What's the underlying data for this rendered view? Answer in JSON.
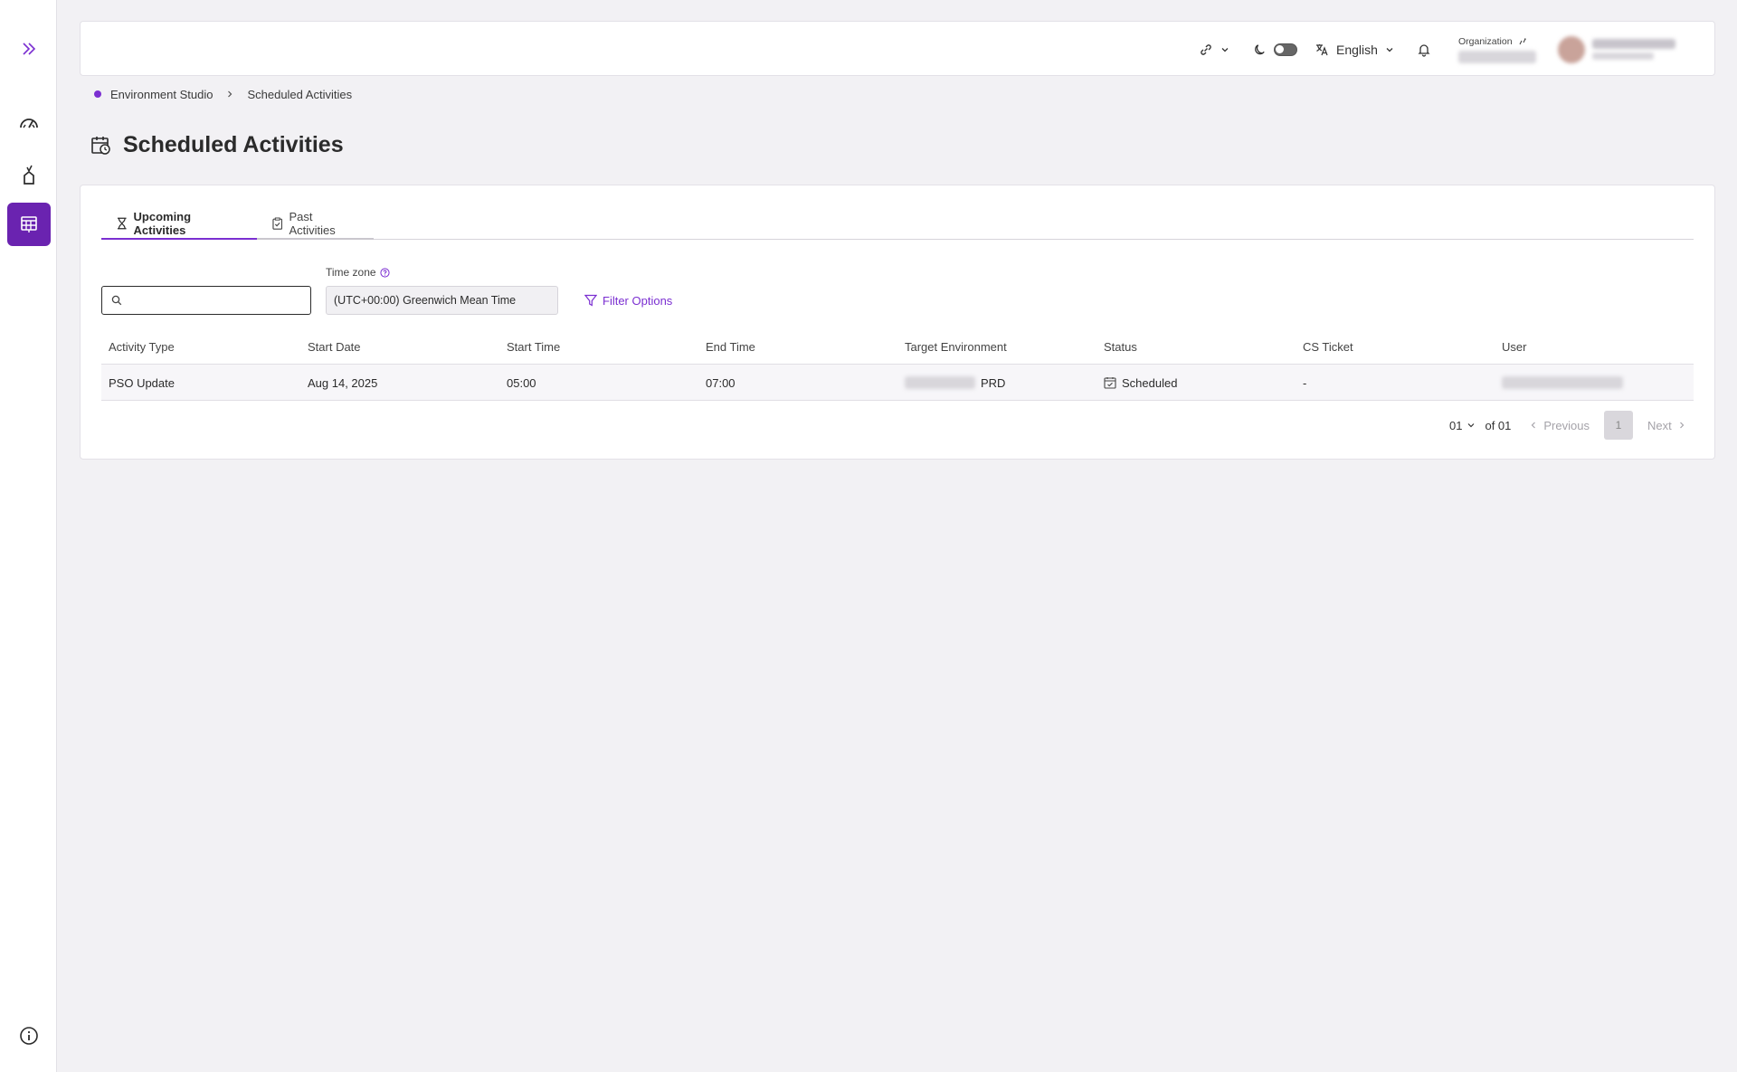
{
  "sidebar": {
    "items": [
      {
        "icon": "expand-chevrons-icon"
      },
      {
        "icon": "dashboard-gauge-icon"
      },
      {
        "icon": "deploy-icon"
      },
      {
        "icon": "calendar-grid-icon"
      }
    ],
    "footer_icon": "info-icon"
  },
  "topbar": {
    "language": "English",
    "organization_label": "Organization"
  },
  "breadcrumb": {
    "root": "Environment Studio",
    "current": "Scheduled Activities"
  },
  "page": {
    "title": "Scheduled Activities"
  },
  "tabs": [
    {
      "label": "Upcoming Activities",
      "active": true
    },
    {
      "label": "Past Activities",
      "active": false
    }
  ],
  "filters": {
    "search_placeholder": "",
    "timezone_label": "Time zone",
    "timezone_value": "(UTC+00:00) Greenwich Mean Time",
    "filter_button": "Filter Options"
  },
  "table": {
    "columns": [
      "Activity Type",
      "Start Date",
      "Start Time",
      "End Time",
      "Target Environment",
      "Status",
      "CS Ticket",
      "User"
    ],
    "rows": [
      {
        "activity_type": "PSO Update",
        "start_date": "Aug 14, 2025",
        "start_time": "05:00",
        "end_time": "07:00",
        "target_environment": "PRD",
        "status": "Scheduled",
        "cs_ticket": "-"
      }
    ]
  },
  "pagination": {
    "page_size": "01",
    "of_total": "of 01",
    "previous": "Previous",
    "current_page": "1",
    "next": "Next"
  },
  "colors": {
    "accent": "#7b2fd1",
    "sidebar_active": "#6a23b0",
    "background": "#f2f1f4"
  }
}
